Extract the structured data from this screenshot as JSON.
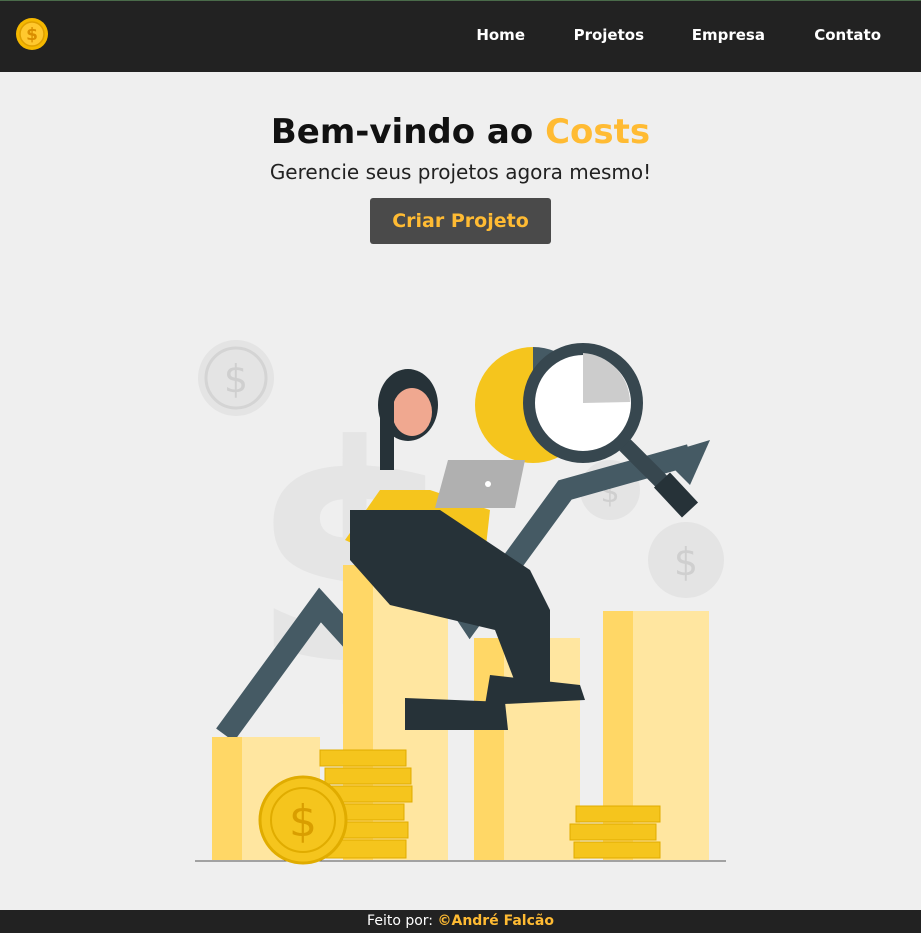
{
  "navbar": {
    "logo_icon": "dollar-coin-icon",
    "links": [
      "Home",
      "Projetos",
      "Empresa",
      "Contato"
    ]
  },
  "hero": {
    "title_prefix": "Bem-vindo ao",
    "title_accent": "Costs",
    "subtitle": "Gerencie seus projetos agora mesmo!",
    "cta_label": "Criar Projeto",
    "illustration": "savings-illustration"
  },
  "footer": {
    "label": "Feito por:",
    "author": "©André Falcão"
  },
  "colors": {
    "accent": "#ffbb33",
    "dark": "#222222",
    "button_bg": "#4a4a4a",
    "background": "#efefef"
  }
}
